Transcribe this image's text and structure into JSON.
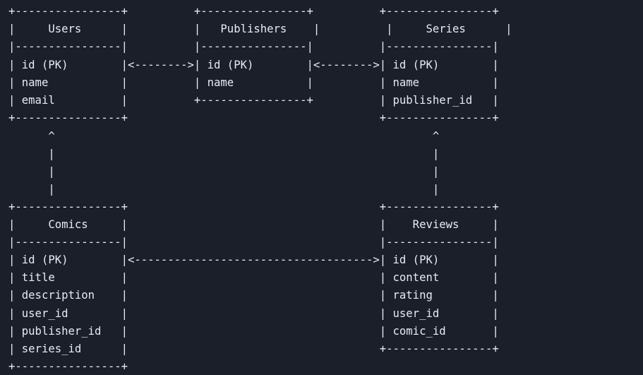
{
  "diagram": {
    "lines": [
      "+----------------+          +----------------+          +----------------+",
      "|     Users      |          |   Publishers    |          |     Series      |",
      "|----------------|          |----------------|          |----------------|",
      "| id (PK)        |<-------->| id (PK)        |<-------->| id (PK)        |",
      "| name           |          | name           |          | name           |",
      "| email          |          +----------------+          | publisher_id   |",
      "+----------------+                                      +----------------+",
      "      ^                                                         ^",
      "      |                                                         |",
      "      |                                                         |",
      "      |                                                         |",
      "+----------------+                                      +----------------+",
      "|     Comics     |                                      |    Reviews     |",
      "|----------------|                                      |----------------|",
      "| id (PK)        |<------------------------------------>| id (PK)        |",
      "| title          |                                      | content        |",
      "| description    |                                      | rating         |",
      "| user_id        |                                      | user_id        |",
      "| publisher_id   |                                      | comic_id       |",
      "| series_id      |                                      +----------------+",
      "+----------------+"
    ]
  }
}
